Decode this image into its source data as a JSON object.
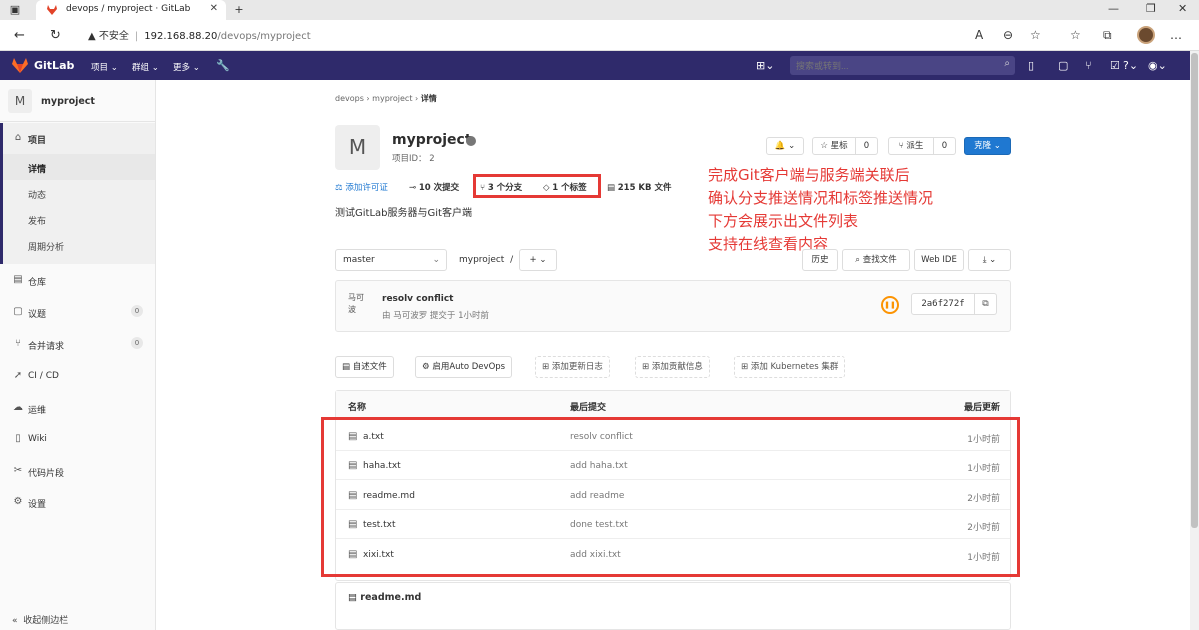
{
  "browser": {
    "tab_title": "devops / myproject · GitLab",
    "security_label": "不安全",
    "url_host": "192.168.88.20",
    "url_path": "/devops/myproject"
  },
  "header": {
    "brand": "GitLab",
    "menu": [
      "项目",
      "群组",
      "更多"
    ],
    "search_placeholder": "搜索或转到..."
  },
  "sidebar": {
    "project_initial": "M",
    "project_name": "myproject",
    "section_label": "项目",
    "subitems": [
      "详情",
      "动态",
      "发布",
      "周期分析"
    ],
    "items": [
      {
        "label": "仓库",
        "icon": "book-icon"
      },
      {
        "label": "议题",
        "count": "0",
        "icon": "issues-icon"
      },
      {
        "label": "合并请求",
        "count": "0",
        "icon": "merge-request-icon"
      },
      {
        "label": "CI / CD",
        "icon": "rocket-icon"
      },
      {
        "label": "运维",
        "icon": "cloud-icon"
      },
      {
        "label": "Wiki",
        "icon": "wiki-icon"
      },
      {
        "label": "代码片段",
        "icon": "scissors-icon"
      },
      {
        "label": "设置",
        "icon": "gear-icon"
      }
    ],
    "collapse_label": "收起侧边栏"
  },
  "breadcrumb": [
    "devops",
    "myproject",
    "详情"
  ],
  "project": {
    "initial": "M",
    "name": "myproject",
    "id_label": "项目ID： 2",
    "description": "测试GitLab服务器与Git客户端",
    "star_label": "星标",
    "star_count": "0",
    "fork_label": "派生",
    "fork_count": "0",
    "clone_label": "克隆"
  },
  "stats": {
    "license": "添加许可证",
    "commits": "10 次提交",
    "branches": "3 个分支",
    "tags": "1 个标签",
    "size": "215 KB 文件"
  },
  "annotation": [
    "完成Git客户端与服务端关联后",
    "确认分支推送情况和标签推送情况",
    "下方会展示出文件列表",
    "支持在线查看内容"
  ],
  "repo": {
    "branch": "master",
    "path": "myproject",
    "history": "历史",
    "find_file": "查找文件",
    "web_ide": "Web IDE"
  },
  "commit": {
    "avatar_alt": "马可波",
    "message": "resolv conflict",
    "meta": "由 马可波罗 提交于 1小时前",
    "sha": "2a6f272f"
  },
  "quick_actions": [
    "自述文件",
    "启用Auto DevOps",
    "添加更新日志",
    "添加贡献信息",
    "添加 Kubernetes 集群"
  ],
  "files": {
    "headers": [
      "名称",
      "最后提交",
      "最后更新"
    ],
    "rows": [
      {
        "name": "a.txt",
        "commit": "resolv conflict",
        "time": "1小时前"
      },
      {
        "name": "haha.txt",
        "commit": "add haha.txt",
        "time": "1小时前"
      },
      {
        "name": "readme.md",
        "commit": "add readme",
        "time": "2小时前"
      },
      {
        "name": "test.txt",
        "commit": "done test.txt",
        "time": "2小时前"
      },
      {
        "name": "xixi.txt",
        "commit": "add xixi.txt",
        "time": "1小时前"
      }
    ]
  },
  "readme_title": "readme.md",
  "colors": {
    "header": "#2f2a6b",
    "accent": "#1f78d1",
    "annotation": "#e53935"
  }
}
